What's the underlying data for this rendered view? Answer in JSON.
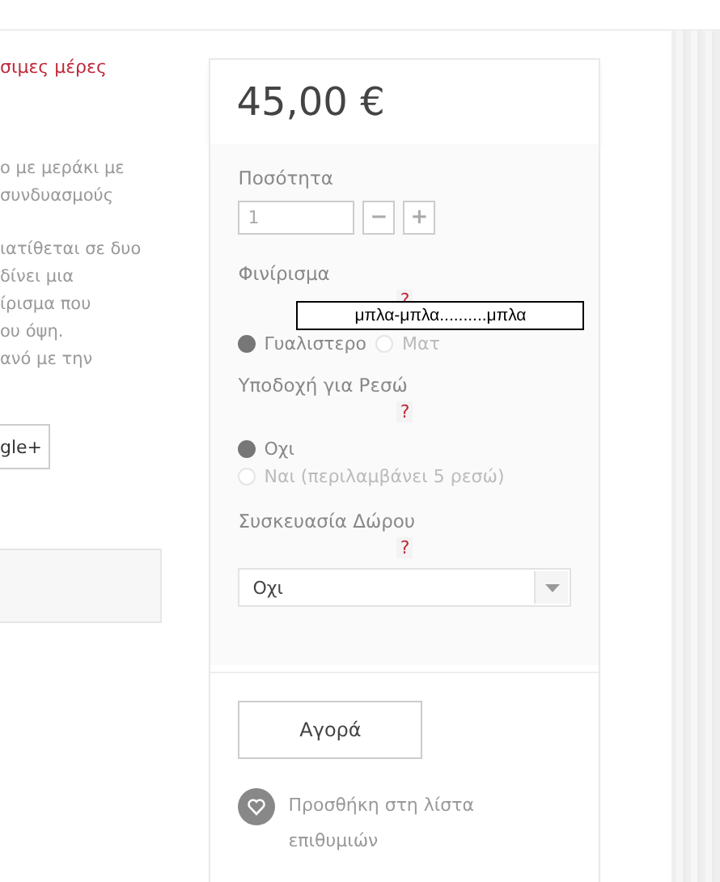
{
  "left_column": {
    "notice": "σιμες μέρες",
    "description_paragraphs": [
      [
        "ο με μεράκι με",
        "συνδυασμούς"
      ],
      [
        "ιατίθεται σε δυο",
        "δίνει μια",
        "ίρισμα που",
        "ου όψη.",
        "ανό με την"
      ]
    ],
    "share_button": "gle+"
  },
  "product": {
    "price": "45,00 €",
    "quantity": {
      "label": "Ποσότητα",
      "value": "1",
      "minus": "−",
      "plus": "+"
    },
    "options": [
      {
        "kind": "radio",
        "label": "Φινίρισμα",
        "help": "?",
        "tooltip": "μπλα-μπλα..........μπλα",
        "choices": [
          {
            "label": "Γυαλιστερο",
            "selected": true
          },
          {
            "label": "Ματ",
            "selected": false
          }
        ]
      },
      {
        "kind": "radio-stacked",
        "label": "Υποδοχή για Ρεσώ",
        "help": "?",
        "choices": [
          {
            "label": "Οχι",
            "selected": true
          },
          {
            "label": "Ναι (περιλαμβάνει 5 ρεσώ)",
            "selected": false
          }
        ]
      },
      {
        "kind": "select",
        "label": "Συσκευασία Δώρου",
        "help": "?",
        "value": "Οχι"
      }
    ],
    "buy_button": "Αγορά",
    "wishlist": "Προσθήκη στη λίστα επιθυμιών"
  }
}
